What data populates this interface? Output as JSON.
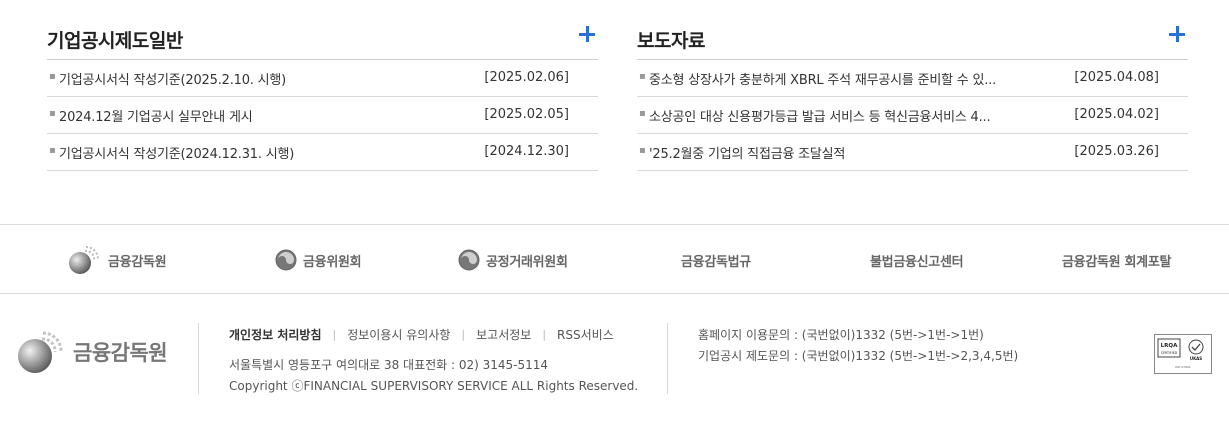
{
  "boards": {
    "disclosure": {
      "title": "기업공시제도일반",
      "items": [
        {
          "title": "기업공시서식 작성기준(2025.2.10. 시행)",
          "date": "[2025.02.06]"
        },
        {
          "title": "2024.12월 기업공시 실무안내 게시",
          "date": "[2025.02.05]"
        },
        {
          "title": "기업공시서식 작성기준(2024.12.31. 시행)",
          "date": "[2024.12.30]"
        }
      ]
    },
    "press": {
      "title": "보도자료",
      "items": [
        {
          "title": "중소형 상장사가 충분하게 XBRL 주석 재무공시를 준비할 수 있...",
          "date": "[2025.04.08]"
        },
        {
          "title": "소상공인 대상 신용평가등급 발급 서비스 등 혁신금융서비스 4...",
          "date": "[2025.04.02]"
        },
        {
          "title": "'25.2월중 기업의 직접금융 조달실적",
          "date": "[2025.03.26]"
        }
      ]
    }
  },
  "partners": [
    {
      "label": "금융감독원",
      "icon": "fss-logo-icon"
    },
    {
      "label": "금융위원회",
      "icon": "fsc-emblem-icon"
    },
    {
      "label": "공정거래위원회",
      "icon": "ftc-emblem-icon"
    },
    {
      "label": "금융감독법규",
      "icon": ""
    },
    {
      "label": "불법금융신고센터",
      "icon": ""
    },
    {
      "label": "금융감독원 회계포탈",
      "icon": ""
    }
  ],
  "footer": {
    "logo_text": "금융감독원",
    "links": [
      "개인정보 처리방침",
      "정보이용시 유의사항",
      "보고서정보",
      "RSS서비스"
    ],
    "address": "서울특별시 영등포구 여의대로 38 대표전화 : 02) 3145-5114",
    "copyright": "Copyright ⓒFINANCIAL SUPERVISORY SERVICE ALL Rights Reserved.",
    "contact_home": "홈페이지 이용문의 : (국번없이)1332 (5번->1번->1번)",
    "contact_disclosure": "기업공시 제도문의 : (국번없이)1332 (5번->1번->2,3,4,5번)",
    "cert": {
      "line1": "LRQA",
      "line2": "CERTIFIED",
      "line3": "UKAS",
      "line4": "ISO 27001"
    }
  },
  "colors": {
    "accent": "#2a6fd6",
    "text": "#333333",
    "muted": "#666666",
    "divider": "#dcdcdc"
  }
}
